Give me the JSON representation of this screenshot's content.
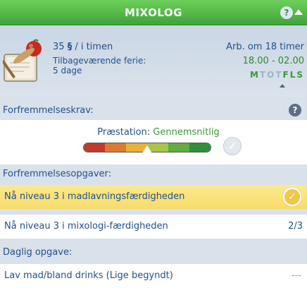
{
  "header": {
    "title": "MIXOLOG",
    "help_label": "?"
  },
  "job": {
    "pay_amount": "35",
    "currency_symbol": "§",
    "pay_unit": "/ i timen",
    "vacation_label": "Tilbageværende ferie:",
    "vacation_value": "5 dage",
    "work_in": "Arb. om 18 timer",
    "hours": "18.00 - 02.00",
    "days": [
      {
        "letter": "M",
        "active": true
      },
      {
        "letter": "T",
        "active": false
      },
      {
        "letter": "O",
        "active": false
      },
      {
        "letter": "T",
        "active": false
      },
      {
        "letter": "F",
        "active": true
      },
      {
        "letter": "L",
        "active": true
      },
      {
        "letter": "S",
        "active": true
      }
    ]
  },
  "requirements": {
    "label": "Forfremmelseskrav:",
    "help_label": "?",
    "performance_label": "Præstation:",
    "performance_value": "Gennemsnitlig",
    "performance_level": 0.5,
    "bar_colors": [
      "#c23b2c",
      "#de7a2e",
      "#e8b23a",
      "#a9c64a",
      "#5fae3e",
      "#2f8f3a"
    ]
  },
  "tasks": {
    "label": "Forfremmelsesopgaver:",
    "items": [
      {
        "text": "Nå niveau 3 i madlavningsfærdigheden",
        "complete": true
      },
      {
        "text": "Nå niveau 3 i mixologi-færdigheden",
        "progress": "2/3"
      }
    ]
  },
  "daily": {
    "label": "Daglig opgave:",
    "text": "Lav mad/bland drinks (Lige begyndt)",
    "progress": "---"
  },
  "icons": {
    "career": "cookbook-icon",
    "check": "checkmark-icon",
    "collapse": "chevron-up-icon"
  },
  "colors": {
    "header_green": "#4cb845",
    "text_blue": "#1f4f8e",
    "accent_green": "#3a9a35",
    "highlight_yellow": "#f6dc6a"
  }
}
